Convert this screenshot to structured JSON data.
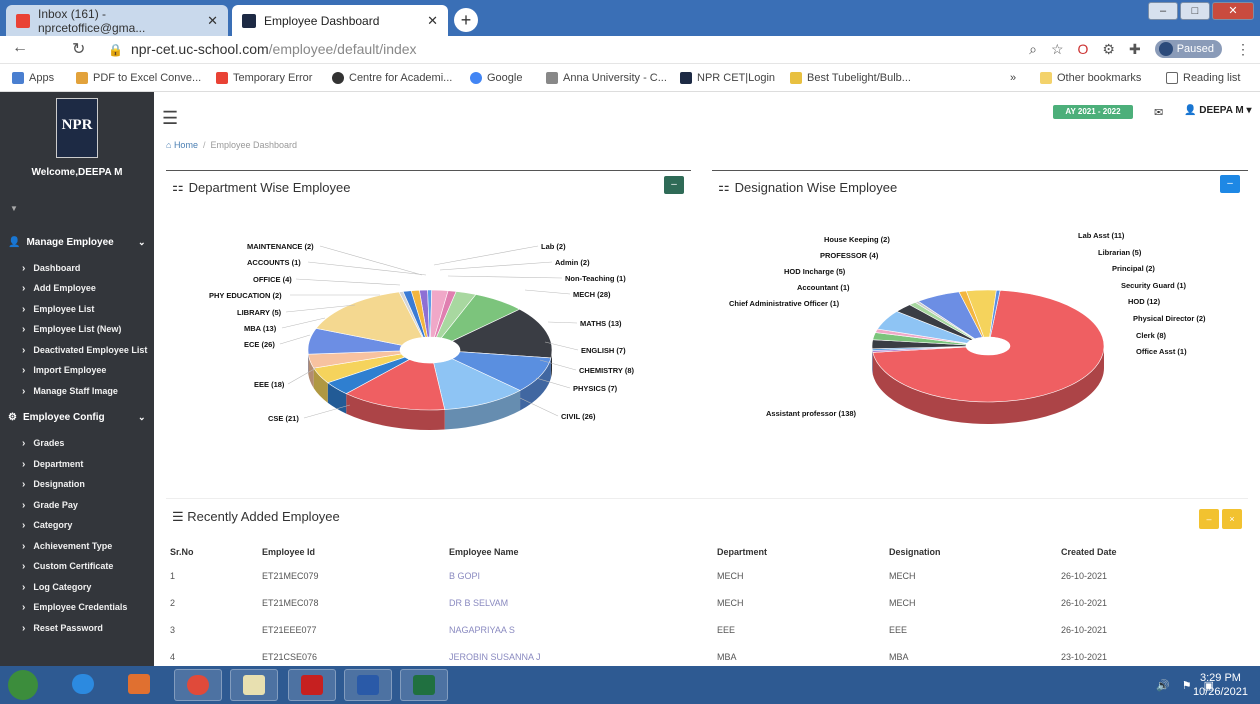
{
  "browser": {
    "tabs": [
      {
        "title": "Inbox (161) - nprcetoffice@gma..."
      },
      {
        "title": "Employee Dashboard"
      }
    ],
    "url_host": "npr-cet.uc-school.com",
    "url_path": "/employee/default/index",
    "profile_status": "Paused",
    "bookmarks": [
      "Apps",
      "PDF to Excel Conve...",
      "Temporary Error",
      "Centre for Academi...",
      "Google",
      "Anna University - C...",
      "NPR CET|Login",
      "Best Tubelight/Bulb...",
      "Other bookmarks",
      "Reading list"
    ]
  },
  "sidebar": {
    "logo_text": "NPR",
    "welcome": "Welcome,DEEPA M",
    "sections": [
      {
        "label": "Manage Employee",
        "items": [
          "Dashboard",
          "Add Employee",
          "Employee List",
          "Employee List (New)",
          "Deactivated Employee List",
          "Import Employee",
          "Manage Staff Image"
        ]
      },
      {
        "label": "Employee Config",
        "items": [
          "Grades",
          "Department",
          "Designation",
          "Grade Pay",
          "Category",
          "Achievement Type",
          "Custom Certificate",
          "Log Category",
          "Employee Credentials",
          "Reset Password"
        ]
      }
    ]
  },
  "header": {
    "year_badge": "AY 2021 - 2022",
    "user": "DEEPA M"
  },
  "breadcrumb": {
    "home": "Home",
    "current": "Employee Dashboard"
  },
  "department_panel": {
    "title": "Department Wise Employee"
  },
  "designation_panel": {
    "title": "Designation Wise Employee"
  },
  "chart_data": [
    {
      "type": "pie",
      "title": "Department Wise Employee",
      "labels": [
        "MAINTENANCE (2)",
        "ACCOUNTS (1)",
        "OFFICE (4)",
        "PHY EDUCATION (2)",
        "LIBRARY (5)",
        "MBA (13)",
        "ECE (26)",
        "EEE (18)",
        "CSE (21)",
        "CIVIL (26)",
        "PHYSICS (7)",
        "CHEMISTRY (8)",
        "ENGLISH (7)",
        "MATHS (13)",
        "MECH (28)",
        "Non-Teaching (1)",
        "Admin (2)",
        "Lab (2)"
      ],
      "categories": [
        "MAINTENANCE",
        "ACCOUNTS",
        "OFFICE",
        "PHY EDUCATION",
        "LIBRARY",
        "MBA",
        "ECE",
        "EEE",
        "CSE",
        "CIVIL",
        "PHYSICS",
        "CHEMISTRY",
        "ENGLISH",
        "MATHS",
        "MECH",
        "Non-Teaching",
        "Admin",
        "Lab"
      ],
      "values": [
        2,
        1,
        4,
        2,
        5,
        13,
        26,
        18,
        21,
        26,
        7,
        8,
        7,
        13,
        28,
        1,
        2,
        2
      ],
      "colors": [
        "#8e6fd4",
        "#5c9ee8",
        "#f0a8c8",
        "#e07fb0",
        "#a8d8a0",
        "#7cc47c",
        "#3a3d44",
        "#5a8fe0",
        "#8ec4f4",
        "#ef5f62",
        "#2f7fd0",
        "#f5d35c",
        "#f7c2a0",
        "#6c8ee4",
        "#f4d890",
        "#d5d5d5",
        "#3a7bd5",
        "#f3b640"
      ]
    },
    {
      "type": "pie",
      "title": "Designation Wise Employee",
      "labels": [
        "Assistant professor (138)",
        "Chief Administrative Officer (1)",
        "Accountant (1)",
        "HOD Incharge (5)",
        "PROFESSOR (4)",
        "House Keeping (2)",
        "Lab Asst (11)",
        "Librarian (5)",
        "Principal (2)",
        "Security Guard (1)",
        "HOD (12)",
        "Physical Director (2)",
        "Clerk (8)",
        "Office Asst (1)"
      ],
      "categories": [
        "Assistant professor",
        "Chief Administrative Officer",
        "Accountant",
        "HOD Incharge",
        "PROFESSOR",
        "House Keeping",
        "Lab Asst",
        "Librarian",
        "Principal",
        "Security Guard",
        "HOD",
        "Physical Director",
        "Clerk",
        "Office Asst"
      ],
      "values": [
        138,
        1,
        1,
        5,
        4,
        2,
        11,
        5,
        2,
        1,
        12,
        2,
        8,
        1
      ],
      "colors": [
        "#ef5f62",
        "#b080d0",
        "#60a0e0",
        "#3a3d44",
        "#7cc47c",
        "#f0a8c8",
        "#8ec4f4",
        "#3a3d44",
        "#a8d8a0",
        "#cccccc",
        "#6c8ee4",
        "#f3b640",
        "#f5d35c",
        "#5a8fe0"
      ]
    }
  ],
  "recent": {
    "title": "Recently Added Employee",
    "columns": [
      "Sr.No",
      "Employee Id",
      "Employee Name",
      "Department",
      "Designation",
      "Created Date"
    ],
    "rows": [
      {
        "sr": "1",
        "id": "ET21MEC079",
        "name": "B GOPI",
        "dept": "MECH",
        "desig": "MECH",
        "date": "26-10-2021"
      },
      {
        "sr": "2",
        "id": "ET21MEC078",
        "name": "DR B SELVAM",
        "dept": "MECH",
        "desig": "MECH",
        "date": "26-10-2021"
      },
      {
        "sr": "3",
        "id": "ET21EEE077",
        "name": "NAGAPRIYAA S",
        "dept": "EEE",
        "desig": "EEE",
        "date": "26-10-2021"
      },
      {
        "sr": "4",
        "id": "ET21CSE076",
        "name": "JEROBIN SUSANNA J",
        "dept": "MBA",
        "desig": "MBA",
        "date": "23-10-2021"
      }
    ]
  },
  "taskbar": {
    "time": "3:29 PM",
    "date": "10/26/2021"
  },
  "colors": {
    "sidebar": "#33363b",
    "accent_blue": "#1e88e5",
    "badge_green": "#4caf7a",
    "yellow": "#f2c230"
  }
}
